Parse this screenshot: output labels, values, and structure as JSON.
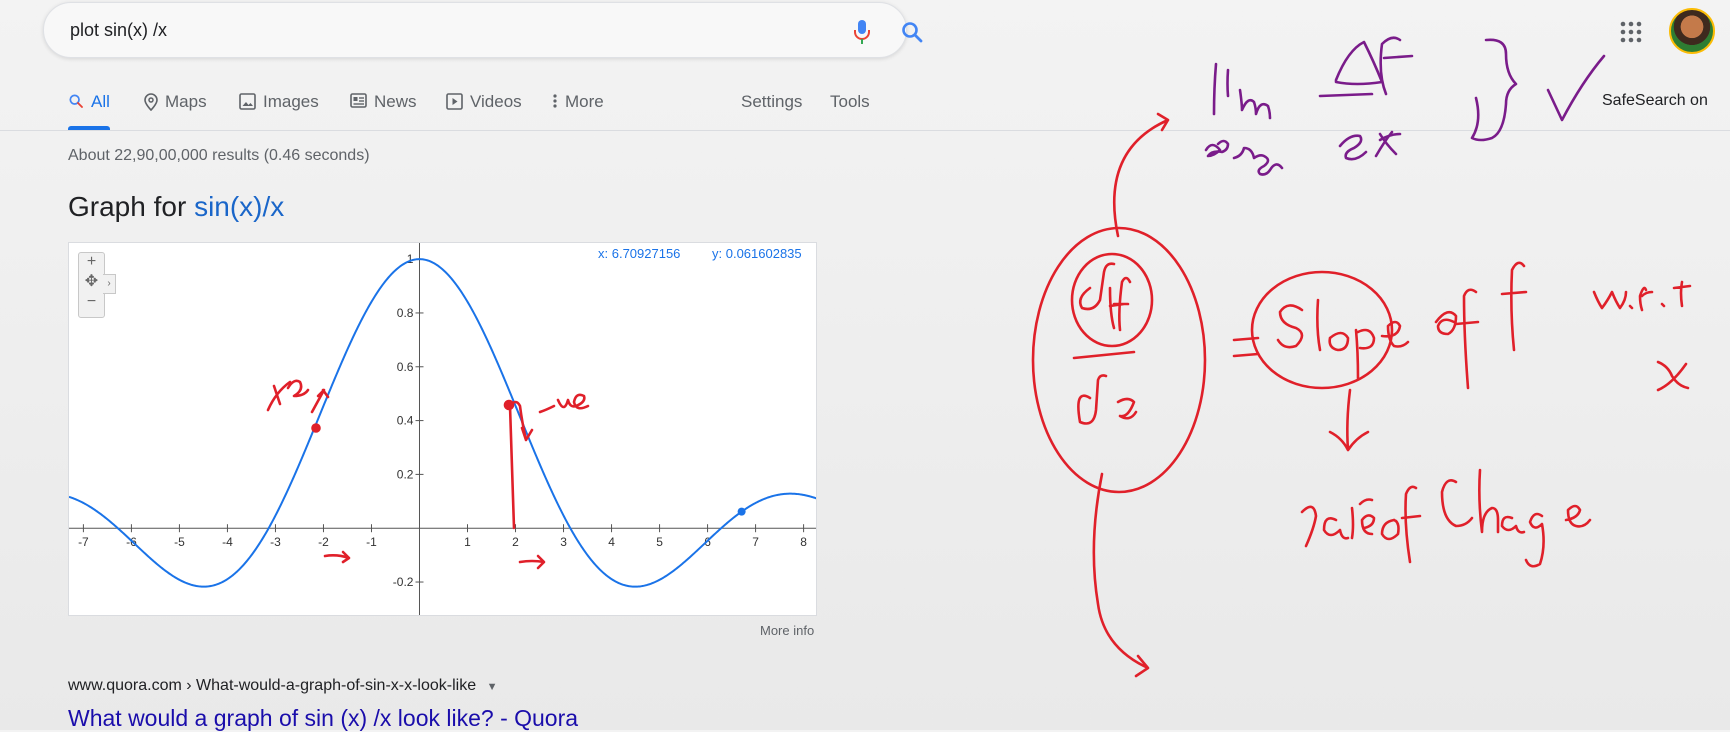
{
  "search": {
    "query": "plot sin(x) /x"
  },
  "tabs": [
    {
      "label": "All",
      "icon": "search-icon"
    },
    {
      "label": "Maps",
      "icon": "map-pin-icon"
    },
    {
      "label": "Images",
      "icon": "image-icon"
    },
    {
      "label": "News",
      "icon": "news-icon"
    },
    {
      "label": "Videos",
      "icon": "video-icon"
    },
    {
      "label": "More",
      "icon": "more-vert-icon"
    },
    {
      "label": "Settings"
    },
    {
      "label": "Tools"
    }
  ],
  "safesearch": "SafeSearch on",
  "result_stats": "About 22,90,00,000 results (0.46 seconds)",
  "graph": {
    "title_prefix": "Graph for ",
    "title_query": "sin(x)/x",
    "readout_x": "x: 6.70927156",
    "readout_y": "y: 0.061602835",
    "more_info": "More info",
    "zoom_in": "+",
    "zoom_out": "−"
  },
  "chart_data": {
    "type": "line",
    "function": "sin(x)/x",
    "xlim": [
      -7.3,
      8.3
    ],
    "ylim": [
      -0.33,
      1.06
    ],
    "x_ticks": [
      -7,
      -6,
      -5,
      -4,
      -3,
      -2,
      -1,
      1,
      2,
      3,
      4,
      5,
      6,
      7,
      8
    ],
    "y_ticks": [
      1,
      0.8,
      0.6,
      0.4,
      0.2,
      -0.2
    ],
    "y_tick_labels": [
      "1",
      "0.8",
      "0.6",
      "0.4",
      "0.2",
      "-0.2"
    ],
    "highlight_point": {
      "x": 6.70927156,
      "y": 0.061602835
    },
    "color": "#1a73e8"
  },
  "result": {
    "url": "www.quora.com › What-would-a-graph-of-sin-x-x-look-like",
    "title": "What would a graph of sin (x) /x look like? - Quora"
  },
  "colors": {
    "accent": "#1a73e8",
    "link": "#1a0dab",
    "ink_red": "#e0202a",
    "ink_purple": "#7a1c8a"
  }
}
